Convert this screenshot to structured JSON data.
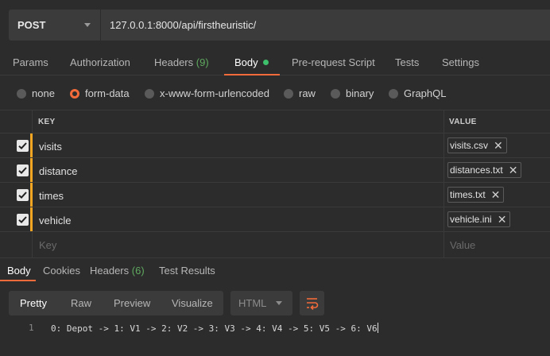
{
  "request": {
    "method": "POST",
    "url": "127.0.0.1:8000/api/firstheuristic/"
  },
  "request_tabs": [
    {
      "label": "Params"
    },
    {
      "label": "Authorization"
    },
    {
      "label": "Headers",
      "count": "(9)"
    },
    {
      "label": "Body",
      "active": true
    },
    {
      "label": "Pre-request Script"
    },
    {
      "label": "Tests"
    },
    {
      "label": "Settings"
    }
  ],
  "body_types": [
    {
      "label": "none"
    },
    {
      "label": "form-data",
      "selected": true
    },
    {
      "label": "x-www-form-urlencoded"
    },
    {
      "label": "raw"
    },
    {
      "label": "binary"
    },
    {
      "label": "GraphQL"
    }
  ],
  "form_table": {
    "headers": {
      "key": "KEY",
      "value": "VALUE"
    },
    "rows": [
      {
        "key": "visits",
        "file": "visits.csv",
        "checked": true
      },
      {
        "key": "distance",
        "file": "distances.txt",
        "checked": true
      },
      {
        "key": "times",
        "file": "times.txt",
        "checked": true
      },
      {
        "key": "vehicle",
        "file": "vehicle.ini",
        "checked": true
      }
    ],
    "placeholder": {
      "key": "Key",
      "value": "Value"
    }
  },
  "response_tabs": [
    {
      "label": "Body",
      "active": true
    },
    {
      "label": "Cookies"
    },
    {
      "label": "Headers",
      "count": "(6)"
    },
    {
      "label": "Test Results"
    }
  ],
  "view_modes": [
    {
      "label": "Pretty",
      "active": true
    },
    {
      "label": "Raw"
    },
    {
      "label": "Preview"
    },
    {
      "label": "Visualize"
    }
  ],
  "format": "HTML",
  "response": {
    "line_number": "1",
    "text": "0: Depot -> 1: V1 -> 2: V2 -> 3: V3 -> 4: V4 -> 5: V5 -> 6: V6"
  },
  "colors": {
    "accent": "#f26b3a",
    "row_marker": "#f5a623",
    "active_dot": "#3dbf6b",
    "count_text": "#5fa95f"
  },
  "icons": [
    "chevron-down-icon",
    "checkbox-check-icon",
    "close-icon",
    "wrap-lines-icon"
  ]
}
